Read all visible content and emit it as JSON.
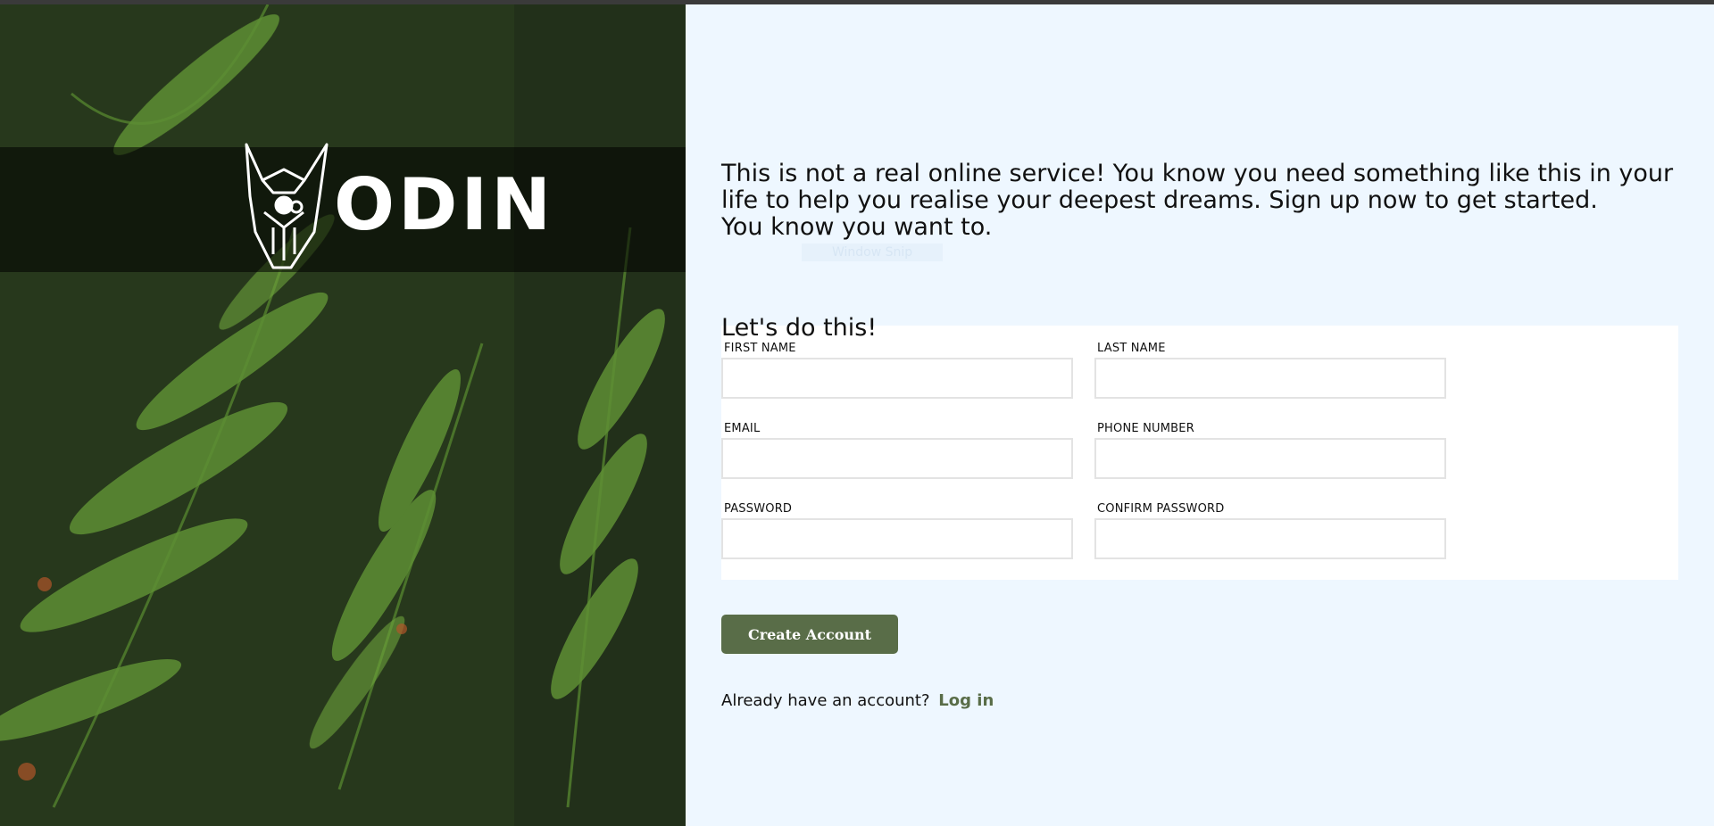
{
  "brand": {
    "name": "ODIN",
    "logo_icon": "viking-helmet-dog-icon"
  },
  "intro": {
    "line1": "This is not a real online service! You know you need something like this in your life to help you realise your deepest dreams. Sign up now to get started.",
    "line2": "You know you want to."
  },
  "ghost_text": "Window Snip",
  "form": {
    "title": "Let's do this!",
    "fields": [
      {
        "label": "FIRST NAME",
        "value": "",
        "placeholder": ""
      },
      {
        "label": "LAST NAME",
        "value": "",
        "placeholder": ""
      },
      {
        "label": "EMAIL",
        "value": "",
        "placeholder": ""
      },
      {
        "label": "PHONE NUMBER",
        "value": "",
        "placeholder": ""
      },
      {
        "label": "PASSWORD",
        "value": "",
        "placeholder": ""
      },
      {
        "label": "CONFIRM PASSWORD",
        "value": "",
        "placeholder": ""
      }
    ],
    "submit_label": "Create Account"
  },
  "footer": {
    "prompt": "Already have an account?",
    "link_label": "Log in"
  },
  "colors": {
    "accent": "#596d48",
    "right_background": "#eef7ff",
    "card_background": "#ffffff",
    "input_border": "#e3e3e3"
  }
}
